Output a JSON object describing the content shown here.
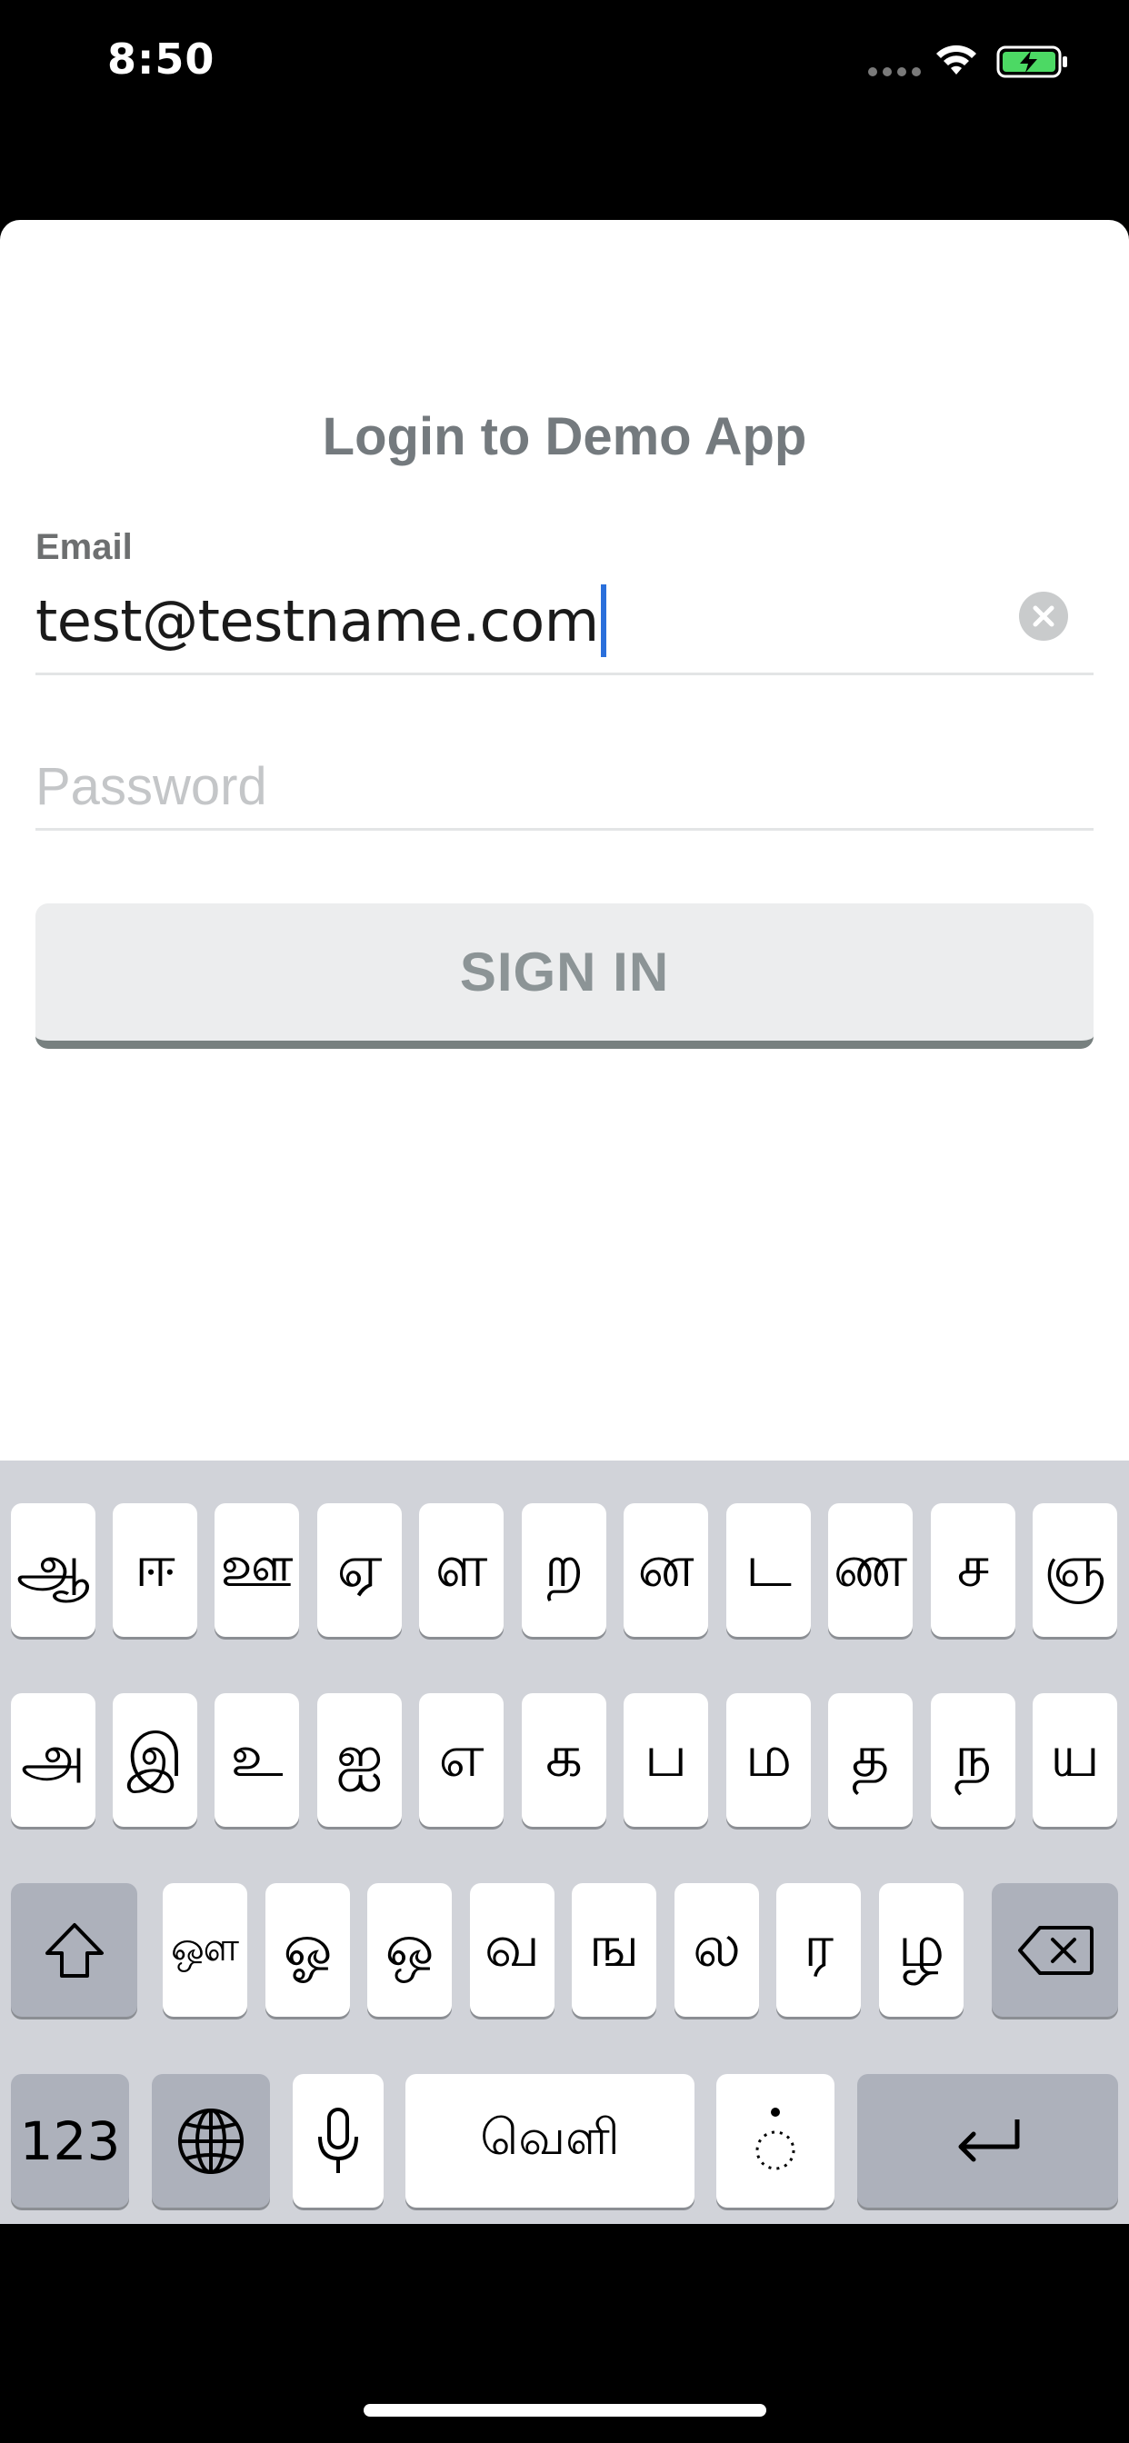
{
  "status_bar": {
    "time": "8:50",
    "icons": [
      "signal-dots-icon",
      "wifi-icon",
      "battery-charging-icon"
    ],
    "battery_color": "#4cd964"
  },
  "login": {
    "title": "Login to Demo App",
    "email_label": "Email",
    "email_value": "test@testname.com",
    "password_placeholder": "Password",
    "sign_in_label": "SIGN IN",
    "title_color": "#747a7e",
    "button_color": "#ecedee",
    "button_border_color": "#77807f"
  },
  "keyboard": {
    "row1": [
      "ஆ",
      "ஈ",
      "ஊ",
      "ஏ",
      "ள",
      "ற",
      "ன",
      "ட",
      "ண",
      "ச",
      "ஞ"
    ],
    "row2": [
      "அ",
      "இ",
      "உ",
      "ஐ",
      "எ",
      "க",
      "ப",
      "ம",
      "த",
      "ந",
      "ய"
    ],
    "row3": [
      "ஔ",
      "ஓ",
      "ஒ",
      "வ",
      "ங",
      "ல",
      "ர",
      "ழ"
    ],
    "numbers_label": "123",
    "space_label": "வெளி",
    "icons": [
      "shift-icon",
      "backspace-icon",
      "globe-icon",
      "microphone-icon",
      "dotted-circle-icon",
      "return-icon"
    ]
  }
}
